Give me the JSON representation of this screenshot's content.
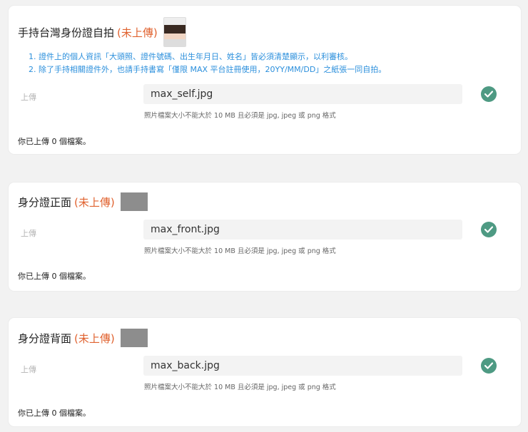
{
  "status_text": "(未上傳)",
  "upload_label": "上傳",
  "size_hint": "照片檔案大小不能大於 10 MB 且必須是 jpg, jpeg 或 png 格式",
  "count_text": "你已上傳 0 個檔案。",
  "colors": {
    "status": "#e0622f",
    "note": "#2b8fdc",
    "check": "#4e9a83"
  },
  "sections": [
    {
      "title": "手持台灣身份證自拍",
      "thumbnail": "selfie-photo",
      "notes": [
        "1.  證件上的個人資訊「大頭照、證件號碼、出生年月日、姓名」皆必須清楚顯示，以利審核。",
        "2.  除了手持相關證件外，也請手持書寫「僅限 MAX 平台註冊使用，20YY/MM/DD」之紙張一同自拍。"
      ],
      "file_name": "max_self.jpg"
    },
    {
      "title": "身分證正面",
      "thumbnail": "redacted",
      "file_name": "max_front.jpg"
    },
    {
      "title": "身分證背面",
      "thumbnail": "redacted",
      "file_name": "max_back.jpg"
    }
  ]
}
